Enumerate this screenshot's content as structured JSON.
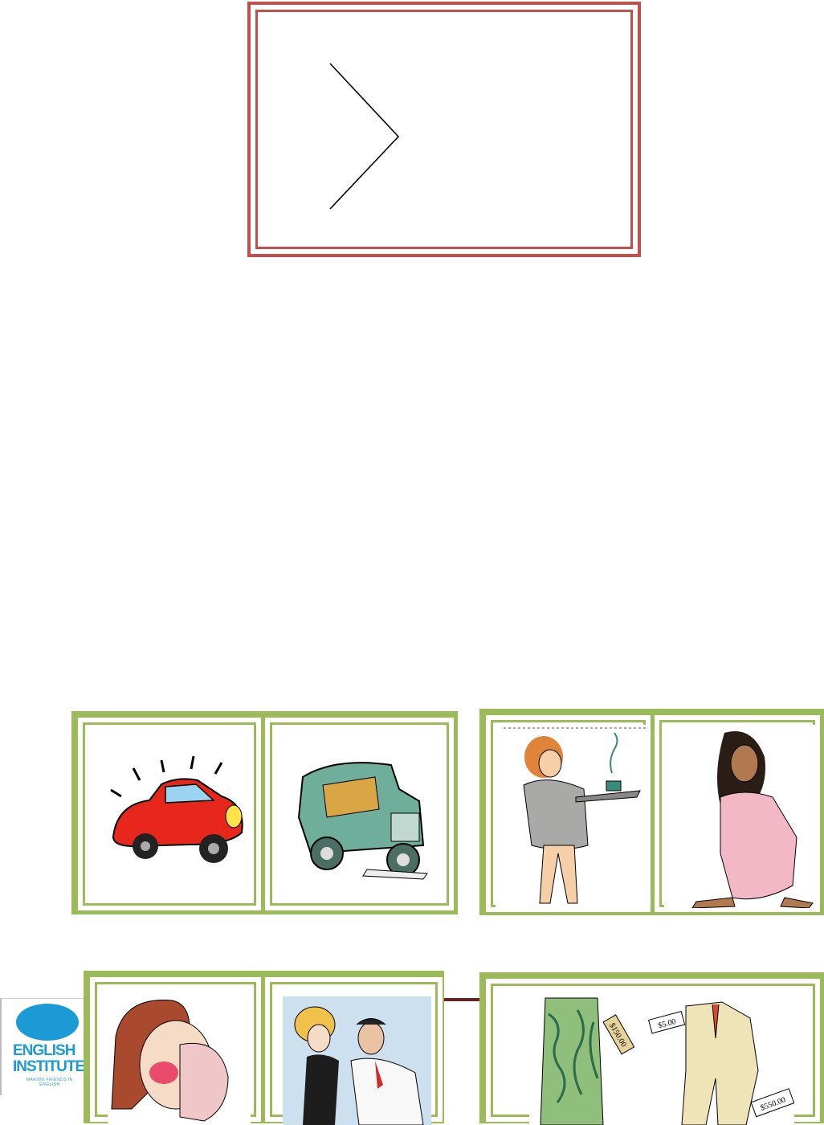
{
  "logo": {
    "line1": "ENGLISH",
    "line2": "INSTITUTE",
    "tagline": "MAKING FRIENDS IN ENGLISH"
  },
  "price_tags": {
    "skirt_tag": "$150.00",
    "suit_tag_top": "$5.00",
    "suit_tag_bottom": "$550.00"
  },
  "colors": {
    "frame_red": "#c0504d",
    "card_green": "#9bbb59",
    "logo_blue": "#1b9ad6"
  }
}
